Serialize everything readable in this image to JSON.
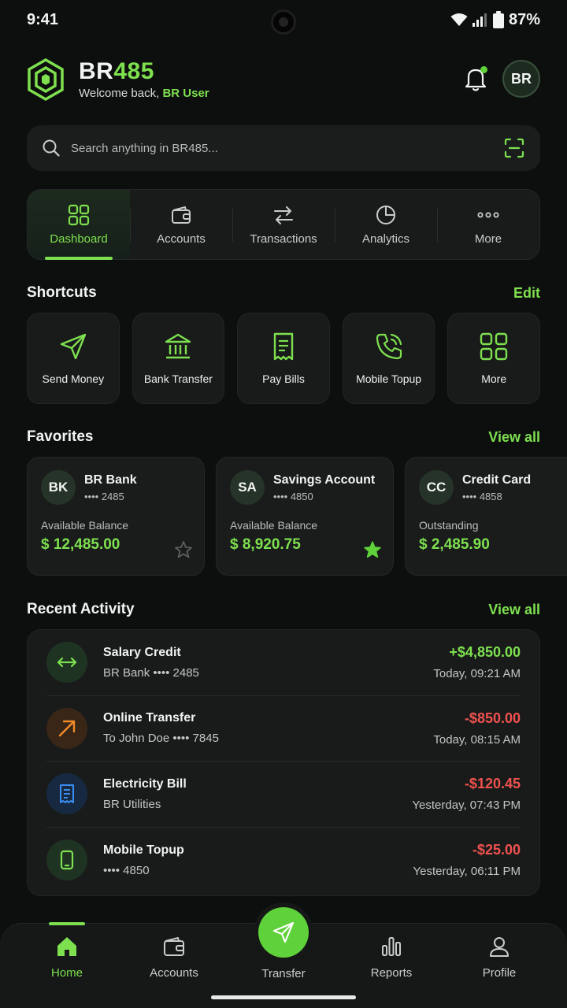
{
  "status_bar": {
    "time": "9:41",
    "battery": "87%"
  },
  "header": {
    "brand_prefix": "BR",
    "brand_suffix": "485",
    "welcome_prefix": "Welcome back, ",
    "welcome_user": "BR User",
    "avatar_initials": "BR"
  },
  "search": {
    "placeholder": "Search anything in BR485..."
  },
  "nav_tabs": [
    {
      "label": "Dashboard",
      "icon": "grid-icon",
      "active": true
    },
    {
      "label": "Accounts",
      "icon": "wallet-icon"
    },
    {
      "label": "Transactions",
      "icon": "swap-icon"
    },
    {
      "label": "Analytics",
      "icon": "pie-chart-icon"
    },
    {
      "label": "More",
      "icon": "more-dots-icon"
    }
  ],
  "shortcuts": {
    "title": "Shortcuts",
    "edit_label": "Edit",
    "items": [
      {
        "label": "Send Money",
        "icon": "send-icon"
      },
      {
        "label": "Bank Transfer",
        "icon": "bank-icon"
      },
      {
        "label": "Pay Bills",
        "icon": "receipt-icon"
      },
      {
        "label": "Mobile Topup",
        "icon": "phone-icon"
      },
      {
        "label": "More",
        "icon": "grid-icon"
      }
    ]
  },
  "favorites": {
    "title": "Favorites",
    "view_all": "View all",
    "items": [
      {
        "initials": "BK",
        "name": "BR Bank",
        "number": "•••• 2485",
        "label": "Available Balance",
        "amount": "$ 12,485.00",
        "starred": false
      },
      {
        "initials": "SA",
        "name": "Savings Account",
        "number": "•••• 4850",
        "label": "Available Balance",
        "amount": "$ 8,920.75",
        "starred": true
      },
      {
        "initials": "CC",
        "name": "Credit Card",
        "number": "•••• 4858",
        "label": "Outstanding",
        "amount": "$ 2,485.90",
        "starred": false
      }
    ]
  },
  "recent_activity": {
    "title": "Recent Activity",
    "view_all": "View all",
    "items": [
      {
        "title": "Salary Credit",
        "subtitle": "BR Bank •••• 2485",
        "amount": "+$4,850.00",
        "time": "Today, 09:21 AM",
        "icon": "exchange-icon",
        "type": "credit"
      },
      {
        "title": "Online Transfer",
        "subtitle": "To John Doe •••• 7845",
        "amount": "-$850.00",
        "time": "Today, 08:15 AM",
        "icon": "arrow-up-right-icon",
        "type": "debit"
      },
      {
        "title": "Electricity Bill",
        "subtitle": "BR Utilities",
        "amount": "-$120.45",
        "time": "Yesterday, 07:43 PM",
        "icon": "bill-icon",
        "type": "debit"
      },
      {
        "title": "Mobile Topup",
        "subtitle": "•••• 4850",
        "amount": "-$25.00",
        "time": "Yesterday, 06:11 PM",
        "icon": "mobile-icon",
        "type": "debit"
      }
    ]
  },
  "bottom_nav": {
    "items": [
      {
        "label": "Home",
        "icon": "home-icon",
        "active": true
      },
      {
        "label": "Accounts",
        "icon": "wallet-icon"
      },
      {
        "label": "Transfer",
        "icon": "send-icon"
      },
      {
        "label": "Reports",
        "icon": "bar-chart-icon"
      },
      {
        "label": "Profile",
        "icon": "user-icon"
      }
    ]
  },
  "colors": {
    "accent": "#7ee04f",
    "credit": "#7ee04f",
    "debit": "#f0524f",
    "background": "#0d0f0e",
    "card": "#181b1a"
  }
}
